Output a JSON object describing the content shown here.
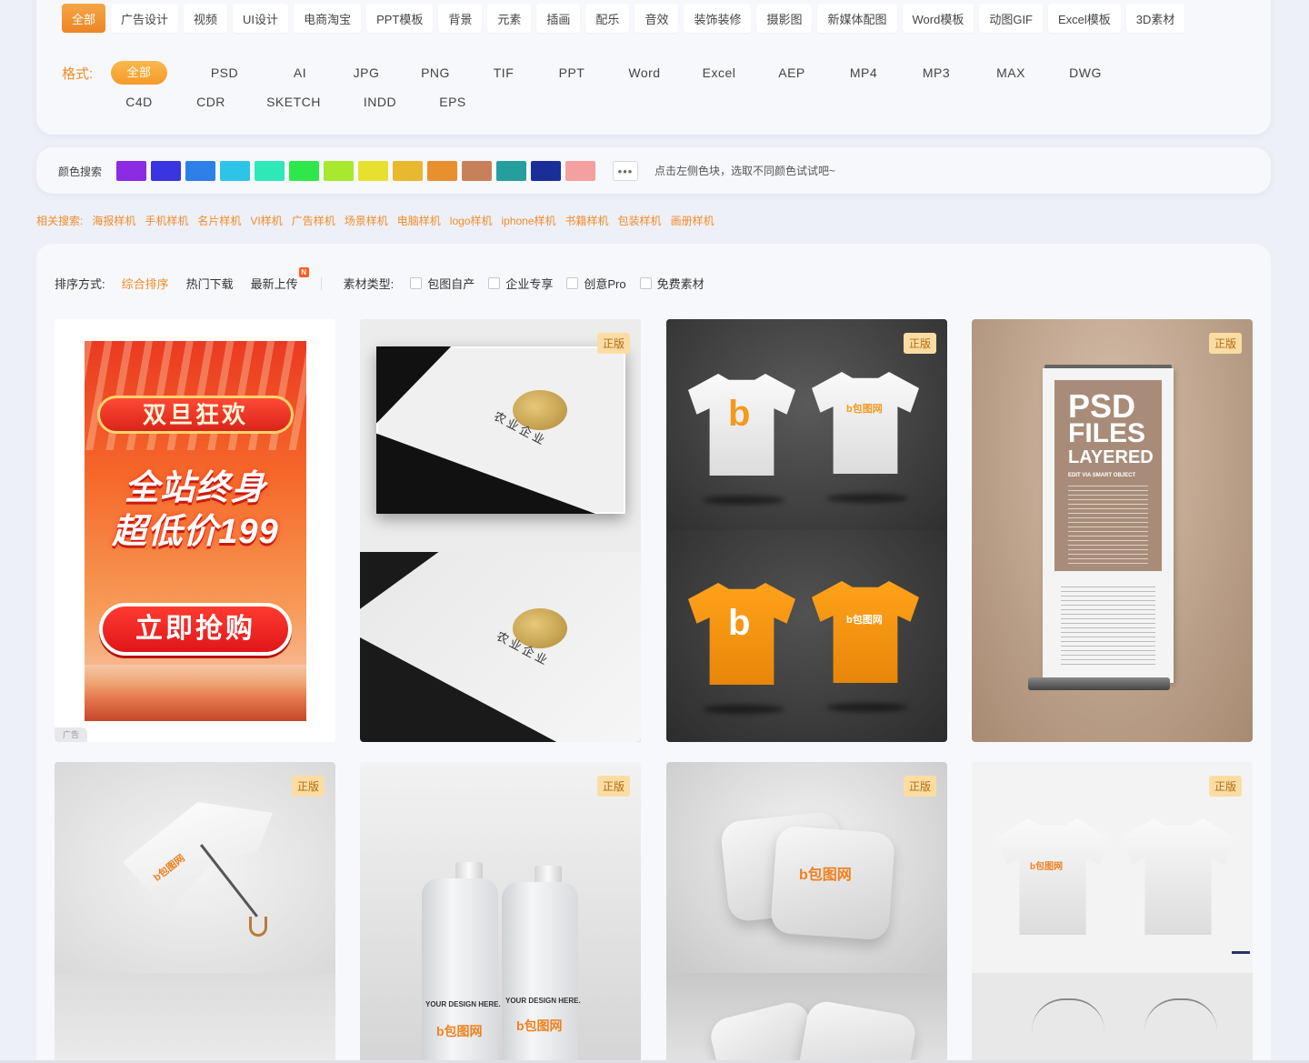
{
  "categories": {
    "items": [
      "全部",
      "广告设计",
      "视频",
      "UI设计",
      "电商淘宝",
      "PPT模板",
      "背景",
      "元素",
      "插画",
      "配乐",
      "音效",
      "装饰装修",
      "摄影图",
      "新媒体配图",
      "Word模板",
      "动图GIF",
      "Excel模板",
      "3D素材"
    ],
    "active_index": 0
  },
  "formats": {
    "label": "格式:",
    "row1": [
      "全部",
      "PSD",
      "AI",
      "JPG",
      "PNG",
      "TIF",
      "PPT",
      "Word",
      "Excel",
      "AEP",
      "MP4",
      "MP3",
      "MAX",
      "DWG"
    ],
    "row2": [
      "C4D",
      "CDR",
      "SKETCH",
      "INDD",
      "EPS"
    ],
    "active_index": 0
  },
  "color_search": {
    "label": "颜色搜索",
    "swatches": [
      "#8b2be2",
      "#3a35e0",
      "#2e7fe8",
      "#2ec4e8",
      "#2ee8b8",
      "#2ee84a",
      "#a8e82e",
      "#e8e02e",
      "#e8b82e",
      "#e8902e",
      "#c8805a",
      "#259e9e",
      "#1a2e9a",
      "#f4a0a0"
    ],
    "more_label": "•••",
    "hint": "点击左侧色块，选取不同颜色试试吧~"
  },
  "related": {
    "label": "相关搜索:",
    "items": [
      "海报样机",
      "手机样机",
      "名片样机",
      "VI样机",
      "广告样机",
      "场景样机",
      "电脑样机",
      "logo样机",
      "iphone样机",
      "书籍样机",
      "包装样机",
      "画册样机"
    ]
  },
  "sort": {
    "label": "排序方式:",
    "options": [
      "综合排序",
      "热门下载",
      "最新上传"
    ],
    "active_index": 0,
    "new_badge": "N"
  },
  "material_type": {
    "label": "素材类型:",
    "options": [
      "包图自产",
      "企业专享",
      "创意Pro",
      "免费素材"
    ]
  },
  "tag_label": "正版",
  "ad": {
    "banner": "双旦狂欢",
    "line1": "全站终身",
    "line2": "超低价199",
    "button": "立即抢购",
    "corner": "广告"
  },
  "business_card": {
    "logo_text": "农业企业"
  },
  "tshirt": {
    "brand_small": "b包图网",
    "brand_big": "b"
  },
  "rollup": {
    "title1": "PSD",
    "title2": "FILES",
    "title3": "LAYERED",
    "subtitle": "EDIT VIA SMART OBJECT"
  },
  "umbrella": {
    "brand": "b包图网"
  },
  "bottle": {
    "label": "YOUR DESIGN HERE.",
    "brand": "b包图网"
  },
  "pillow": {
    "brand": "b包图网"
  },
  "tee2": {
    "brand": "b包图网"
  }
}
